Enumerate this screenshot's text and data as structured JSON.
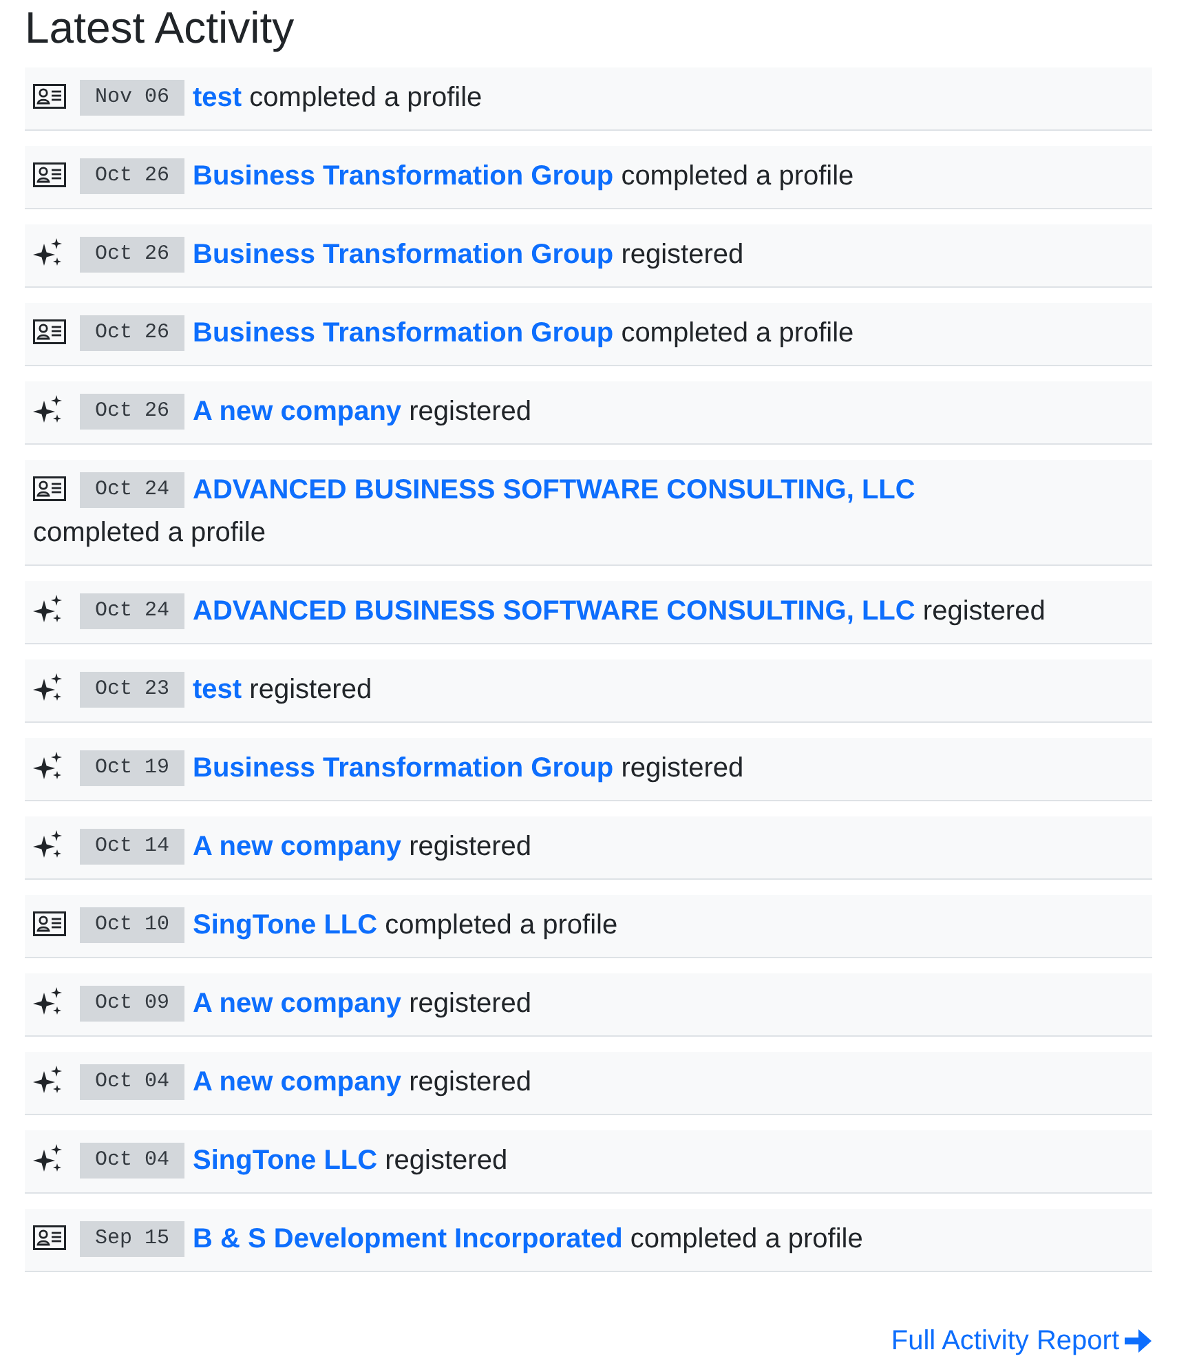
{
  "title": "Latest Activity",
  "activities": [
    {
      "kind": "profile",
      "date": "Nov 06",
      "name": "test",
      "action": "completed a profile"
    },
    {
      "kind": "profile",
      "date": "Oct 26",
      "name": "Business Transformation Group",
      "action": "completed a profile"
    },
    {
      "kind": "registered",
      "date": "Oct 26",
      "name": "Business Transformation Group",
      "action": "registered"
    },
    {
      "kind": "profile",
      "date": "Oct 26",
      "name": "Business Transformation Group",
      "action": "completed a profile"
    },
    {
      "kind": "registered",
      "date": "Oct 26",
      "name": "A new company",
      "action": "registered"
    },
    {
      "kind": "profile",
      "date": "Oct 24",
      "name": "ADVANCED BUSINESS SOFTWARE CONSULTING, LLC",
      "action": "completed a profile"
    },
    {
      "kind": "registered",
      "date": "Oct 24",
      "name": "ADVANCED BUSINESS SOFTWARE CONSULTING, LLC",
      "action": "registered"
    },
    {
      "kind": "registered",
      "date": "Oct 23",
      "name": "test",
      "action": "registered"
    },
    {
      "kind": "registered",
      "date": "Oct 19",
      "name": "Business Transformation Group",
      "action": "registered"
    },
    {
      "kind": "registered",
      "date": "Oct 14",
      "name": "A new company",
      "action": "registered"
    },
    {
      "kind": "profile",
      "date": "Oct 10",
      "name": "SingTone LLC",
      "action": "completed a profile"
    },
    {
      "kind": "registered",
      "date": "Oct 09",
      "name": "A new company",
      "action": "registered"
    },
    {
      "kind": "registered",
      "date": "Oct 04",
      "name": "A new company",
      "action": "registered"
    },
    {
      "kind": "registered",
      "date": "Oct 04",
      "name": "SingTone LLC",
      "action": "registered"
    },
    {
      "kind": "profile",
      "date": "Sep 15",
      "name": "B & S Development Incorporated",
      "action": "completed a profile"
    }
  ],
  "footer_link": {
    "label": "Full Activity Report"
  }
}
